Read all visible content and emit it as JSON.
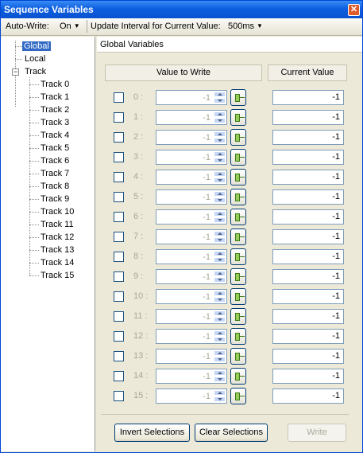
{
  "window": {
    "title": "Sequence Variables",
    "close_glyph": "✕"
  },
  "toolbar": {
    "autowrite_label": "Auto-Write:",
    "autowrite_value": "On",
    "interval_label": "Update Interval for Current Value:",
    "interval_value": "500ms"
  },
  "tree": {
    "global": "Global",
    "local": "Local",
    "track": "Track",
    "tracks": [
      "Track 0",
      "Track 1",
      "Track 2",
      "Track 3",
      "Track 4",
      "Track 5",
      "Track 6",
      "Track 7",
      "Track 8",
      "Track 9",
      "Track 10",
      "Track 11",
      "Track 12",
      "Track 13",
      "Track 14",
      "Track 15"
    ]
  },
  "panel": {
    "title": "Global Variables",
    "col_write": "Value to Write",
    "col_current": "Current Value"
  },
  "rows": [
    {
      "index": "0 :",
      "write": "-1",
      "current": "-1"
    },
    {
      "index": "1 :",
      "write": "-1",
      "current": "-1"
    },
    {
      "index": "2 :",
      "write": "-1",
      "current": "-1"
    },
    {
      "index": "3 :",
      "write": "-1",
      "current": "-1"
    },
    {
      "index": "4 :",
      "write": "-1",
      "current": "-1"
    },
    {
      "index": "5 :",
      "write": "-1",
      "current": "-1"
    },
    {
      "index": "6 :",
      "write": "-1",
      "current": "-1"
    },
    {
      "index": "7 :",
      "write": "-1",
      "current": "-1"
    },
    {
      "index": "8 :",
      "write": "-1",
      "current": "-1"
    },
    {
      "index": "9 :",
      "write": "-1",
      "current": "-1"
    },
    {
      "index": "10 :",
      "write": "-1",
      "current": "-1"
    },
    {
      "index": "11 :",
      "write": "-1",
      "current": "-1"
    },
    {
      "index": "12 :",
      "write": "-1",
      "current": "-1"
    },
    {
      "index": "13 :",
      "write": "-1",
      "current": "-1"
    },
    {
      "index": "14 :",
      "write": "-1",
      "current": "-1"
    },
    {
      "index": "15 :",
      "write": "-1",
      "current": "-1"
    }
  ],
  "buttons": {
    "invert": "Invert Selections",
    "clear": "Clear Selections",
    "write": "Write"
  }
}
